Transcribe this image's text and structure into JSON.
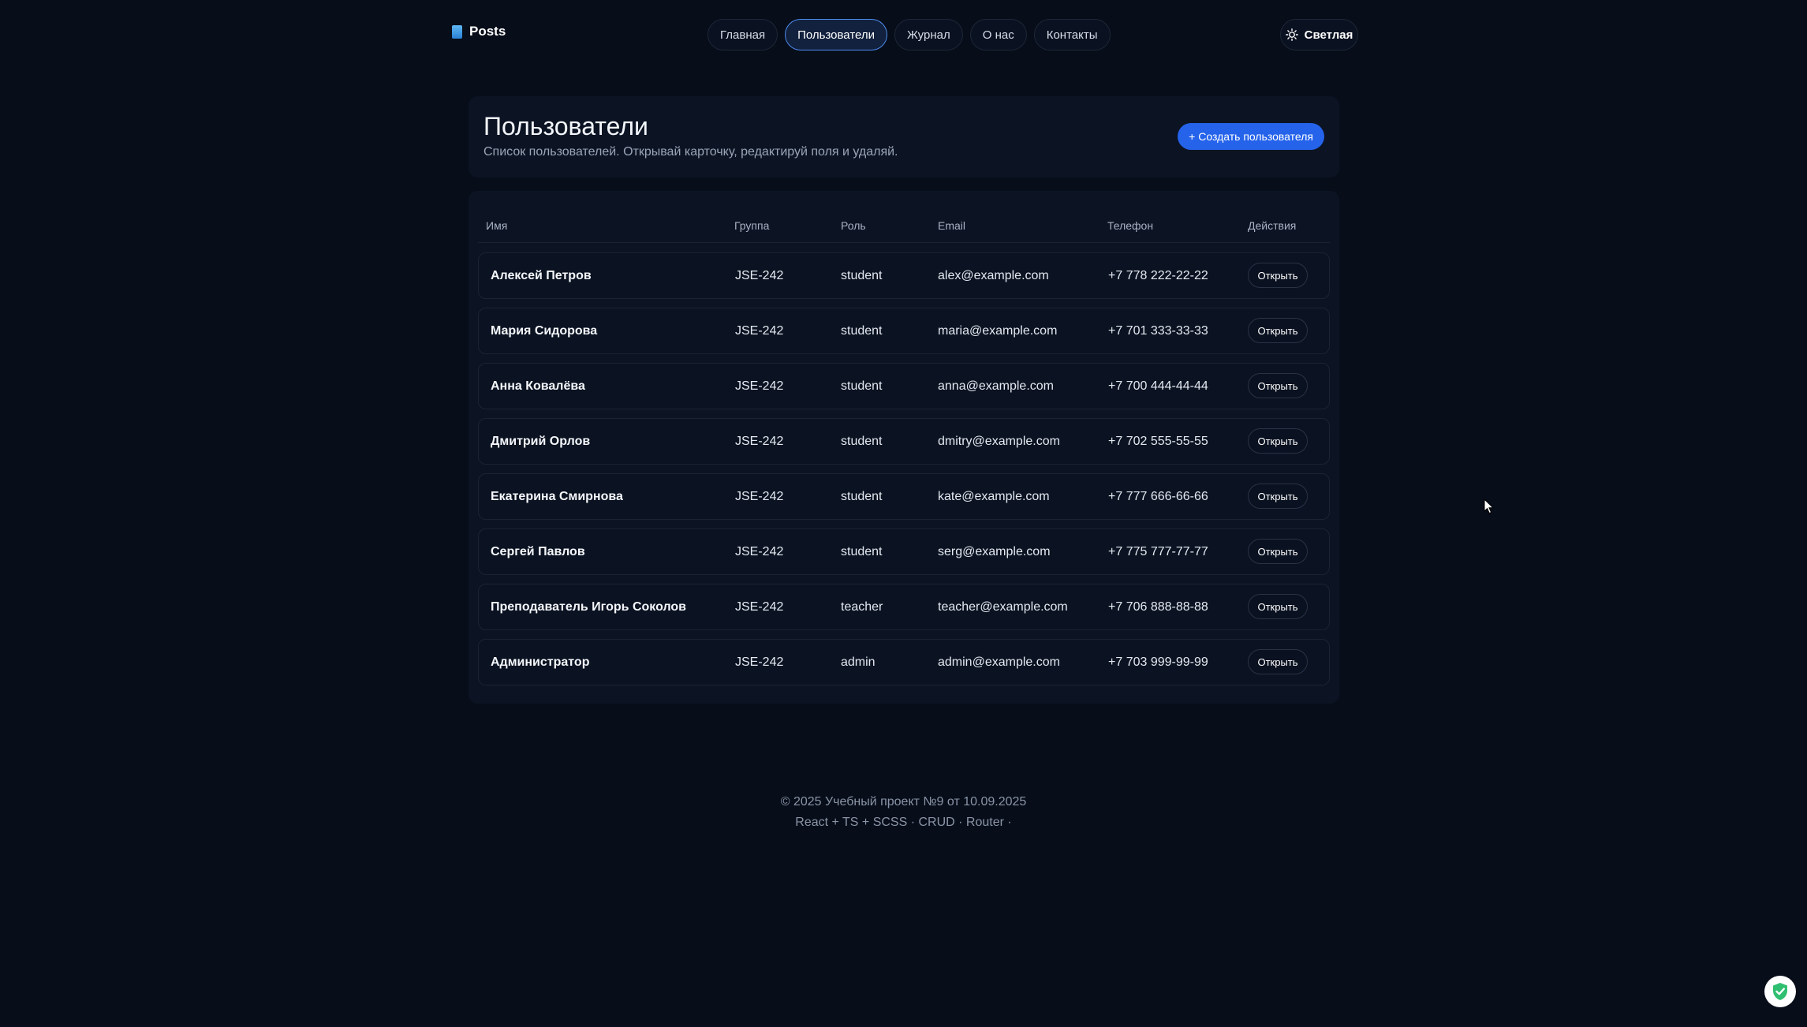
{
  "brand": {
    "title": "Posts",
    "icon": "book-icon"
  },
  "nav": {
    "items": [
      {
        "label": "Главная",
        "active": false
      },
      {
        "label": "Пользователи",
        "active": true
      },
      {
        "label": "Журнал",
        "active": false
      },
      {
        "label": "О нас",
        "active": false
      },
      {
        "label": "Контакты",
        "active": false
      }
    ]
  },
  "theme_toggle": {
    "label": "Светлая",
    "icon": "sun-icon"
  },
  "header_card": {
    "title": "Пользователи",
    "subtitle": "Список пользователей. Открывай карточку, редактируй поля и удаляй.",
    "create_label": "+ Создать пользователя"
  },
  "table": {
    "columns": [
      "Имя",
      "Группа",
      "Роль",
      "Email",
      "Телефон",
      "Действия"
    ],
    "open_label": "Открыть",
    "rows": [
      {
        "name": "Алексей Петров",
        "group": "JSE-242",
        "role": "student",
        "email": "alex@example.com",
        "phone": "+7 778 222-22-22"
      },
      {
        "name": "Мария Сидорова",
        "group": "JSE-242",
        "role": "student",
        "email": "maria@example.com",
        "phone": "+7 701 333-33-33"
      },
      {
        "name": "Анна Ковалёва",
        "group": "JSE-242",
        "role": "student",
        "email": "anna@example.com",
        "phone": "+7 700 444-44-44"
      },
      {
        "name": "Дмитрий Орлов",
        "group": "JSE-242",
        "role": "student",
        "email": "dmitry@example.com",
        "phone": "+7 702 555-55-55"
      },
      {
        "name": "Екатерина Смирнова",
        "group": "JSE-242",
        "role": "student",
        "email": "kate@example.com",
        "phone": "+7 777 666-66-66"
      },
      {
        "name": "Сергей Павлов",
        "group": "JSE-242",
        "role": "student",
        "email": "serg@example.com",
        "phone": "+7 775 777-77-77"
      },
      {
        "name": "Преподаватель Игорь Соколов",
        "group": "JSE-242",
        "role": "teacher",
        "email": "teacher@example.com",
        "phone": "+7 706 888-88-88"
      },
      {
        "name": "Администратор",
        "group": "JSE-242",
        "role": "admin",
        "email": "admin@example.com",
        "phone": "+7 703 999-99-99"
      }
    ]
  },
  "footer": {
    "line1": "© 2025 Учебный проект №9 от 10.09.2025",
    "line2": "React + TS + SCSS · CRUD · Router ·"
  },
  "colors": {
    "accent": "#2563eb",
    "background": "#070d19",
    "card": "#0c1424",
    "active_nav_border": "#4d8cf0"
  }
}
